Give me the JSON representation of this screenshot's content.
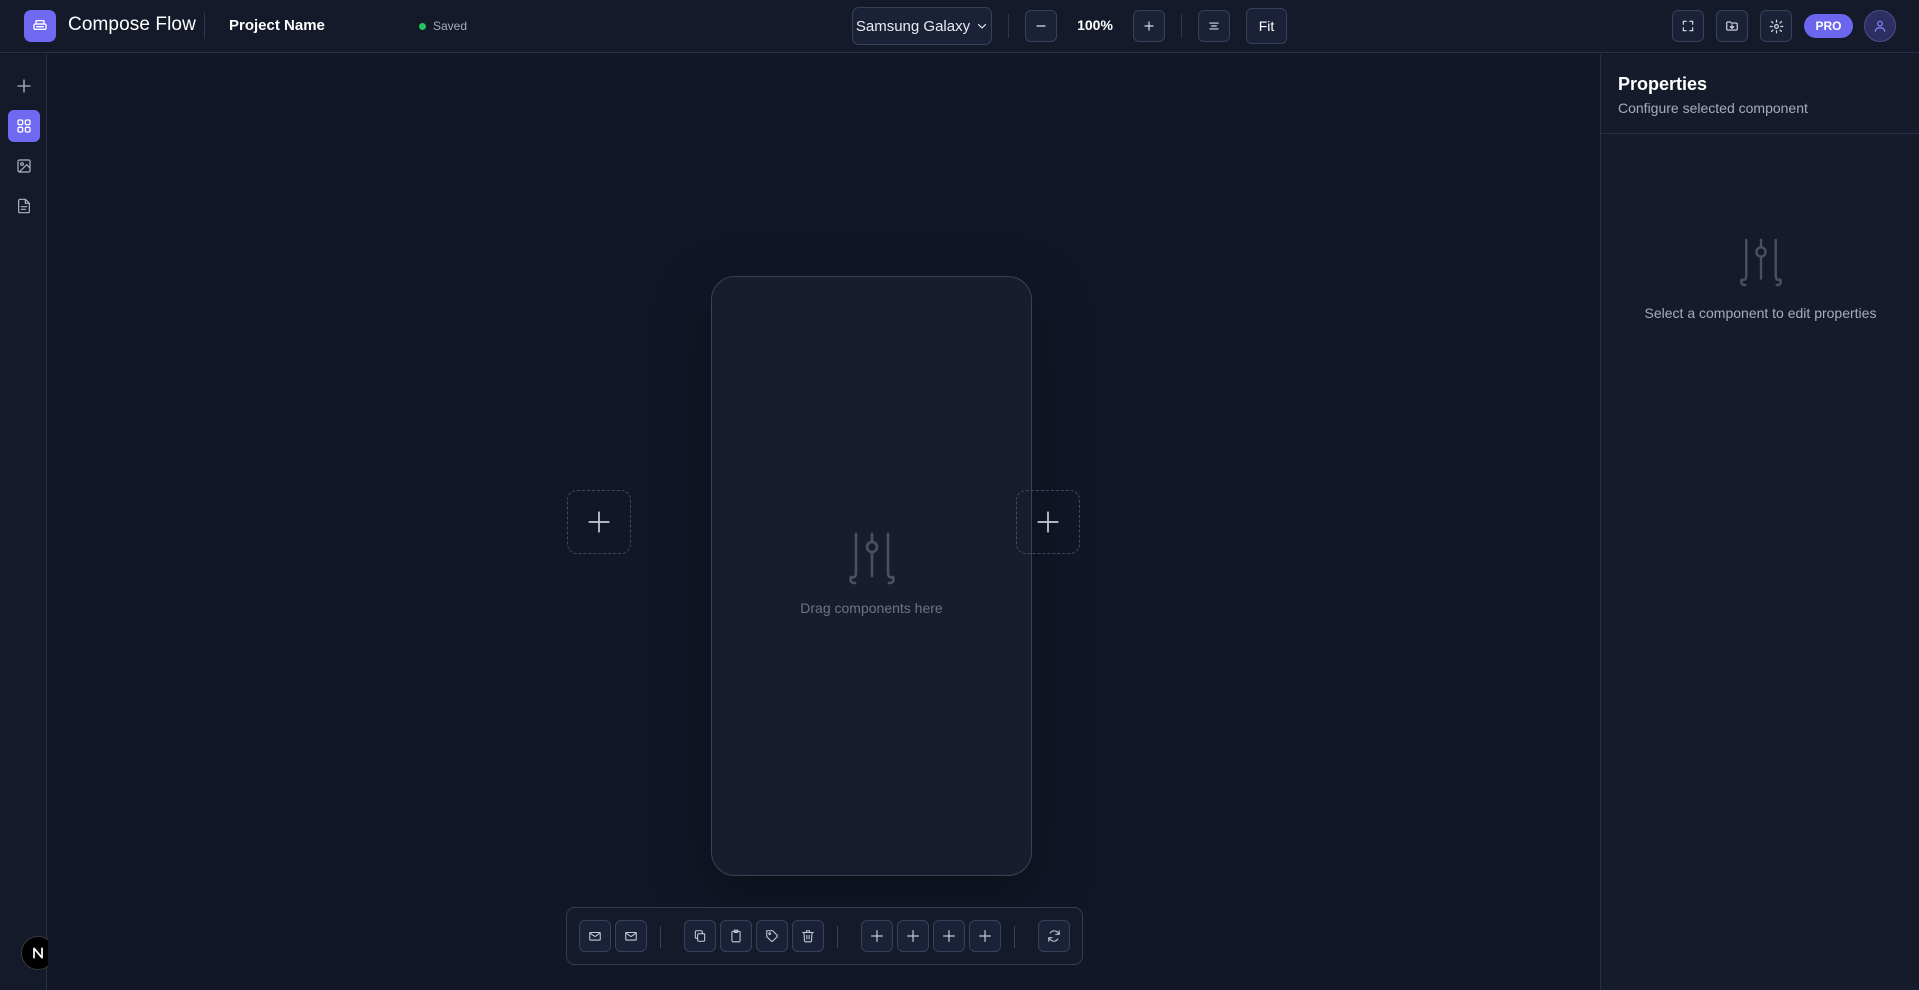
{
  "header": {
    "app_title": "Compose Flow",
    "project_name": "Project Name",
    "save_status": "Saved",
    "device": "Samsung Galaxy",
    "zoom": "100%",
    "fit_label": "Fit",
    "pro_label": "PRO"
  },
  "icons": {
    "logo": "printer-icon",
    "zoom_out": "minus-icon",
    "zoom_in": "plus-icon",
    "align": "align-center-icon",
    "fullscreen": "fullscreen-icon",
    "export": "folder-download-icon",
    "settings": "gear-icon",
    "user": "user-icon"
  },
  "rail": {
    "items": [
      {
        "name": "add",
        "icon": "plus-icon",
        "active": false
      },
      {
        "name": "components",
        "icon": "grid-icon",
        "active": true
      },
      {
        "name": "images",
        "icon": "image-icon",
        "active": false
      },
      {
        "name": "pages",
        "icon": "document-icon",
        "active": false
      }
    ],
    "badge": "N"
  },
  "canvas": {
    "empty_text": "Drag components here"
  },
  "toolbar": {
    "groups": [
      [
        "mail-icon",
        "mail-icon"
      ],
      [
        "copy-icon",
        "clipboard-icon",
        "tag-icon",
        "trash-icon"
      ],
      [
        "plus-icon",
        "plus-icon",
        "plus-icon",
        "plus-icon"
      ],
      [
        "refresh-icon"
      ]
    ]
  },
  "properties": {
    "title": "Properties",
    "subtitle": "Configure selected component",
    "empty_text": "Select a component to edit properties"
  },
  "colors": {
    "accent": "#6f69f1",
    "background": "#111727",
    "panel": "#151a2b",
    "status_saved": "#22c55e"
  }
}
